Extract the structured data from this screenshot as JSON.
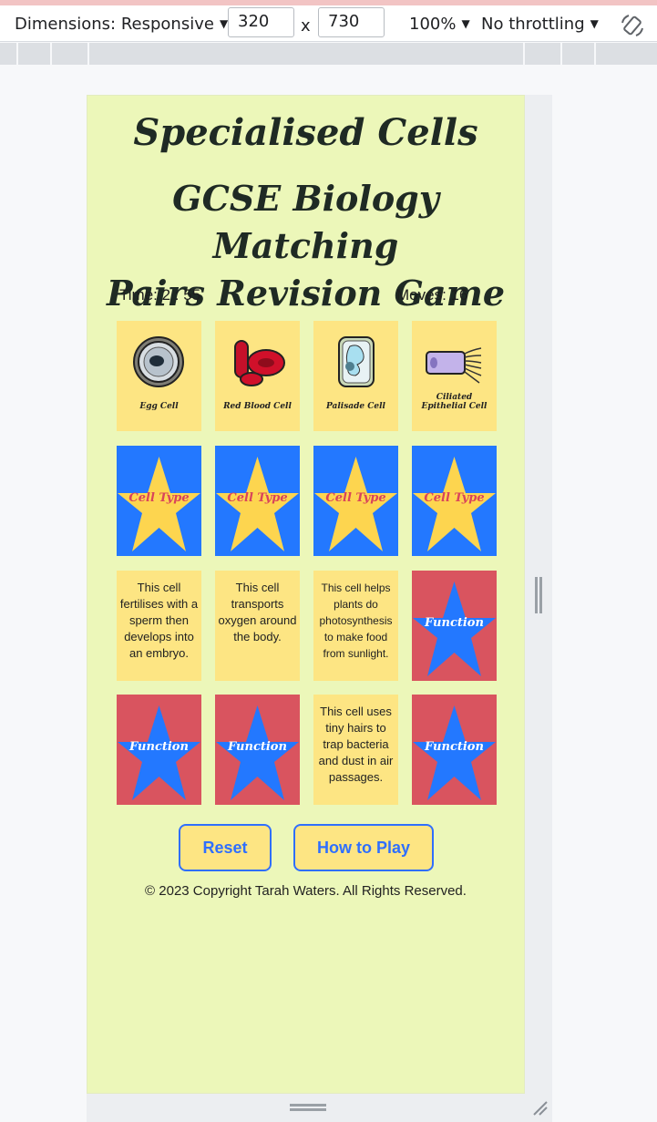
{
  "devtools": {
    "dimensions_label": "Dimensions: Responsive",
    "width": "320",
    "times": "x",
    "height": "730",
    "zoom": "100%",
    "throttling": "No throttling"
  },
  "game": {
    "title": "Specialised Cells",
    "subtitle_line1": "GCSE Biology Matching",
    "subtitle_line2": "Pairs Revision Game",
    "time": "Time: 2 : 55",
    "moves": "Moves: 16",
    "cell_type_cards": [
      {
        "label": "Egg Cell",
        "icon": "egg-cell-icon"
      },
      {
        "label": "Red Blood Cell",
        "icon": "red-blood-cell-icon"
      },
      {
        "label": "Palisade Cell",
        "icon": "palisade-cell-icon"
      },
      {
        "label": "Ciliated Epithelial Cell",
        "icon": "ciliated-epithelial-cell-icon"
      }
    ],
    "cell_type_back_label": "Cell Type",
    "function_back_label": "Function",
    "function_cards": [
      "This cell fertilises with a sperm then develops into an embryo.",
      "This cell transports oxygen around the body.",
      "This cell helps plants do photosynthesis to make food from sunlight.",
      "This cell uses tiny hairs to trap bacteria and dust in air passages."
    ],
    "reset_label": "Reset",
    "how_to_play_label": "How to Play",
    "footer": "© 2023 Copyright Tarah Waters. All Rights Reserved.",
    "colors": {
      "background": "#ecf7b9",
      "card_face": "#fde583",
      "card_back_blue": "#2378ff",
      "card_back_red": "#d9545f",
      "star_yellow": "#fdd54f",
      "star_blue": "#2378ff"
    }
  }
}
